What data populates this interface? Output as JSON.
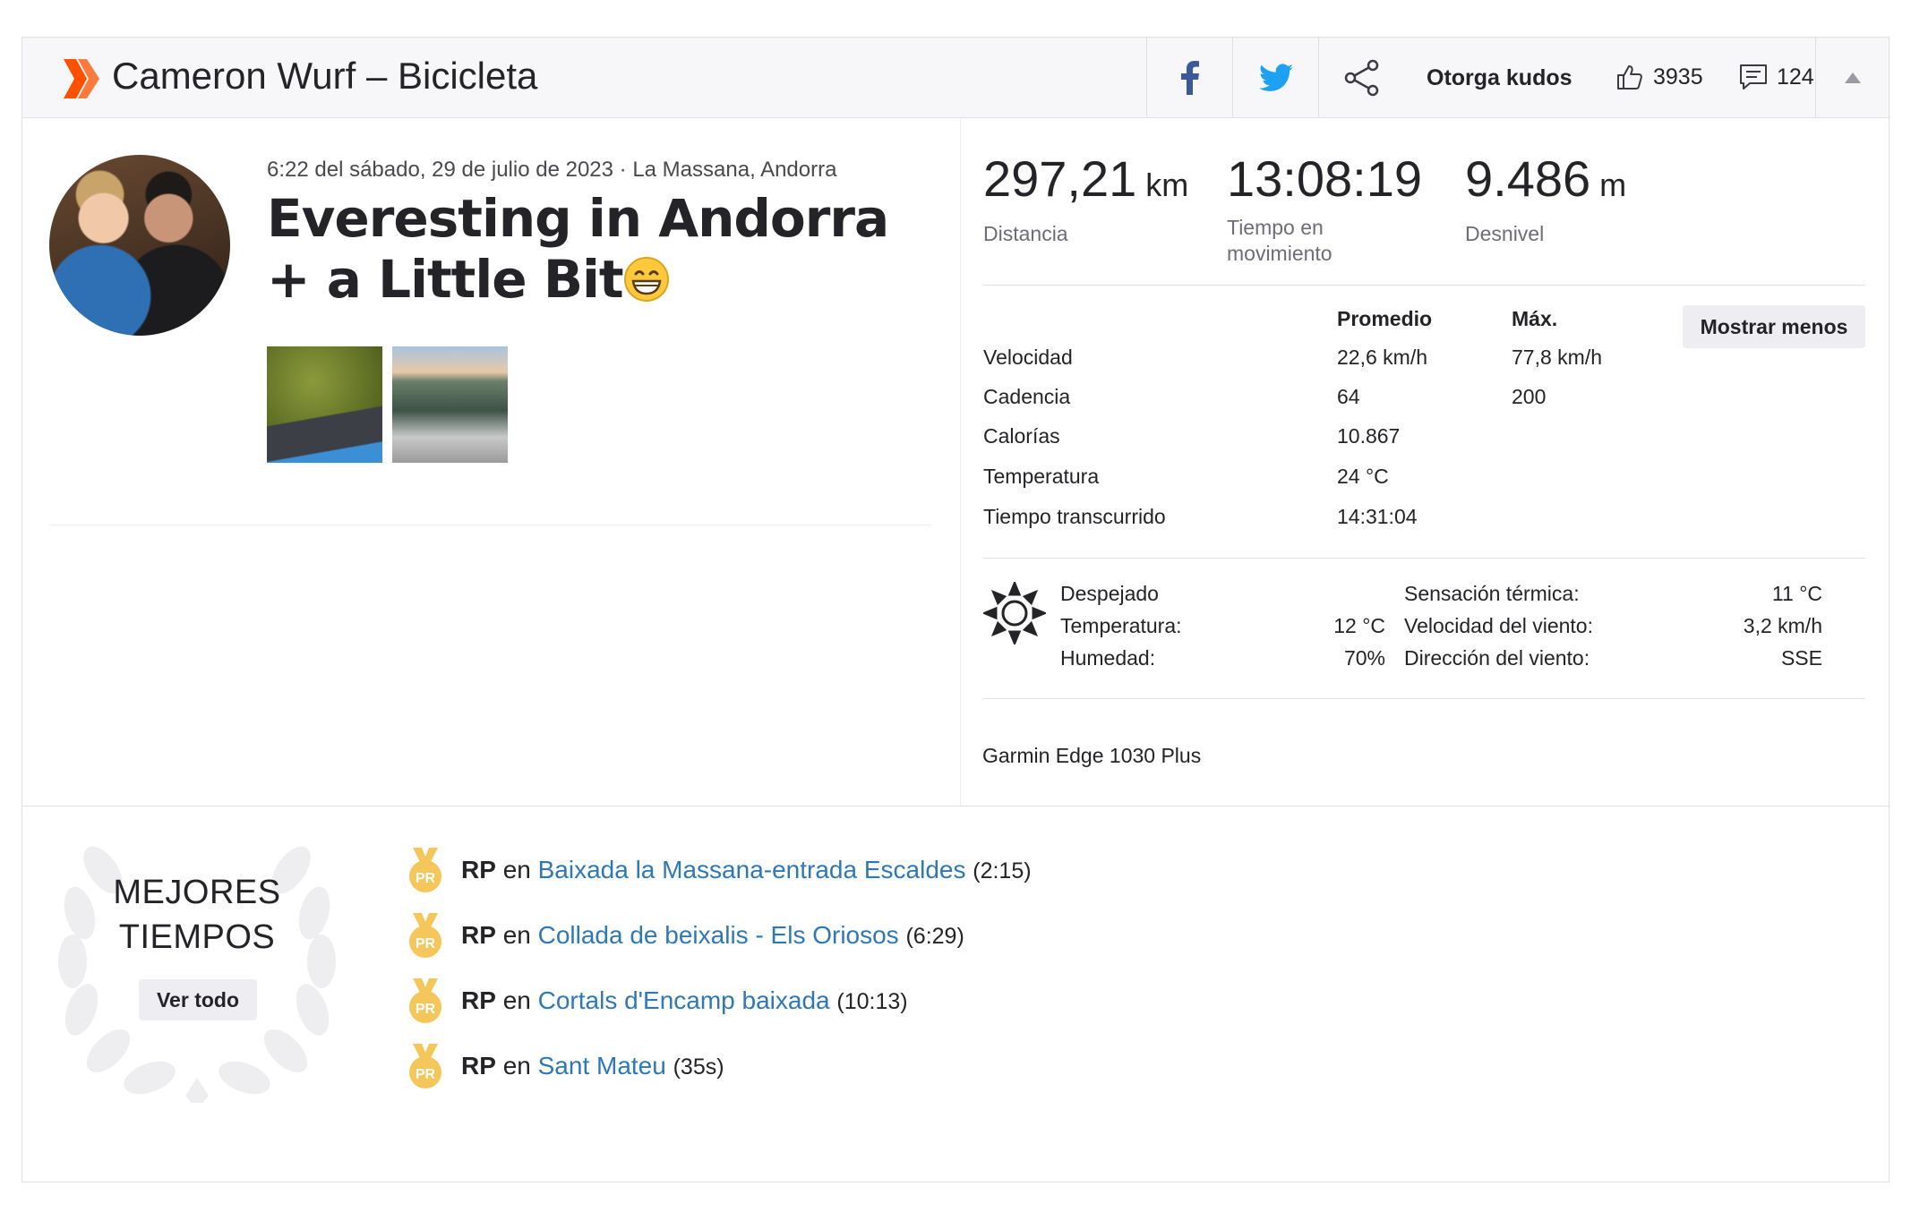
{
  "header": {
    "title": "Cameron Wurf – Bicicleta",
    "kudos_label": "Otorga kudos",
    "kudos_count": "3935",
    "comments_count": "124"
  },
  "activity": {
    "meta": "6:22 del sábado, 29 de julio de 2023 · La Massana, Andorra",
    "title": "Everesting in Andorra + a Little Bit"
  },
  "stats": {
    "distance": {
      "value": "297,21",
      "unit": "km",
      "label": "Distancia"
    },
    "moving_time": {
      "value": "13:08:19",
      "label": "Tiempo en movimiento"
    },
    "elevation": {
      "value": "9.486",
      "unit": "m",
      "label": "Desnivel"
    }
  },
  "table": {
    "avg_header": "Promedio",
    "max_header": "Máx.",
    "show_less": "Mostrar menos",
    "rows": [
      {
        "label": "Velocidad",
        "avg": "22,6 km/h",
        "max": "77,8 km/h"
      },
      {
        "label": "Cadencia",
        "avg": "64",
        "max": "200"
      },
      {
        "label": "Calorías",
        "avg": "10.867",
        "max": ""
      },
      {
        "label": "Temperatura",
        "avg": "24 °C",
        "max": ""
      },
      {
        "label": "Tiempo transcurrido",
        "avg": "14:31:04",
        "max": ""
      }
    ]
  },
  "weather": {
    "condition": "Despejado",
    "temp_label": "Temperatura:",
    "temp_value": "12 °C",
    "humidity_label": "Humedad:",
    "humidity_value": "70%",
    "feels_label": "Sensación térmica:",
    "feels_value": "11 °C",
    "wind_speed_label": "Velocidad del viento:",
    "wind_speed_value": "3,2 km/h",
    "wind_dir_label": "Dirección del viento:",
    "wind_dir_value": "SSE"
  },
  "device": "Garmin Edge 1030 Plus",
  "best_efforts": {
    "title": "MEJORES TIEMPOS",
    "see_all": "Ver todo",
    "medal_text": "PR",
    "prs": [
      {
        "badge": "RP",
        "connector": "en",
        "segment": "Baixada la Massana-entrada Escaldes",
        "time": "(2:15)"
      },
      {
        "badge": "RP",
        "connector": "en",
        "segment": "Collada de beixalis - Els Oriosos",
        "time": "(6:29)"
      },
      {
        "badge": "RP",
        "connector": "en",
        "segment": "Cortals d'Encamp baixada",
        "time": "(10:13)"
      },
      {
        "badge": "RP",
        "connector": "en",
        "segment": "Sant Mateu",
        "time": "(35s)"
      }
    ]
  },
  "colors": {
    "brand": "#fc5200",
    "link": "#2f78b7",
    "facebook": "#3b5998",
    "twitter": "#1da1f2",
    "medal": "#f5c65a"
  },
  "icons": [
    "strava-logo-icon",
    "facebook-icon",
    "twitter-icon",
    "share-icon",
    "thumbs-up-icon",
    "comment-icon",
    "caret-up-icon",
    "sun-icon",
    "laurel-icon",
    "pr-medal-icon",
    "grinning-face-icon"
  ]
}
